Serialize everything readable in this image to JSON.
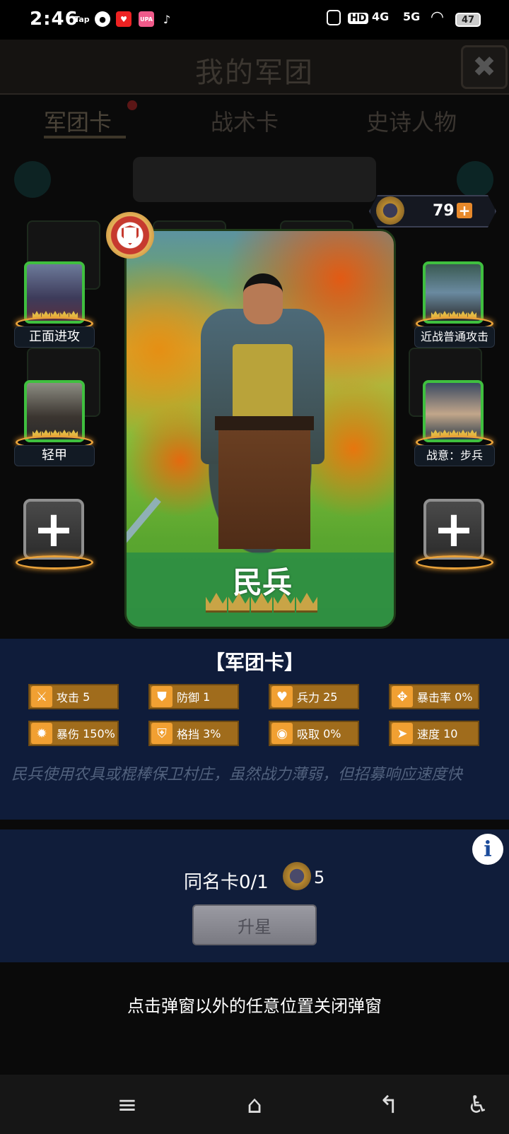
{
  "status": {
    "time": "2:46",
    "apps": [
      "Tap",
      "WeChat",
      "Vivo",
      "UPA",
      "TikTok"
    ],
    "net_hd": "HD",
    "net_4g": "4G",
    "net_5g": "5G",
    "battery": "47"
  },
  "header": {
    "title": "我的军团",
    "close_icon": "close-icon"
  },
  "tabs": [
    {
      "label": "军团卡",
      "active": true
    },
    {
      "label": "战术卡",
      "active": false
    },
    {
      "label": "史诗人物",
      "active": false
    }
  ],
  "currency": {
    "value": "79",
    "plus": "+"
  },
  "card": {
    "name": "民兵",
    "stars": 5
  },
  "slots": {
    "left_top": "正面进攻",
    "left_mid": "轻甲",
    "right_top": "近战普通攻击",
    "right_mid": "战意：步兵",
    "add": "+"
  },
  "info": {
    "type": "【军团卡】",
    "stats": [
      {
        "label": "攻击",
        "value": "5",
        "icon": "sword-icon"
      },
      {
        "label": "防御",
        "value": "1",
        "icon": "shield-icon"
      },
      {
        "label": "兵力",
        "value": "25",
        "icon": "heart-icon"
      },
      {
        "label": "暴击率",
        "value": "0%",
        "icon": "crit-icon"
      },
      {
        "label": "暴伤",
        "value": "150%",
        "icon": "burst-icon"
      },
      {
        "label": "格挡",
        "value": "3%",
        "icon": "block-icon"
      },
      {
        "label": "吸取",
        "value": "0%",
        "icon": "drain-icon"
      },
      {
        "label": "速度",
        "value": "10",
        "icon": "speed-icon"
      }
    ],
    "description": "民兵使用农具或棍棒保卫村庄，虽然战力薄弱，但招募响应速度快"
  },
  "upgrade": {
    "duplicate_label": "同名卡0/1",
    "cost": "5",
    "button": "升星",
    "info": "i"
  },
  "hint": "点击弹窗以外的任意位置关闭弹窗",
  "colors": {
    "panel": "#0f1c3a",
    "stat_bg": "#a06c1c",
    "slot_border": "#3fbf3f",
    "accent": "#e7892b"
  }
}
